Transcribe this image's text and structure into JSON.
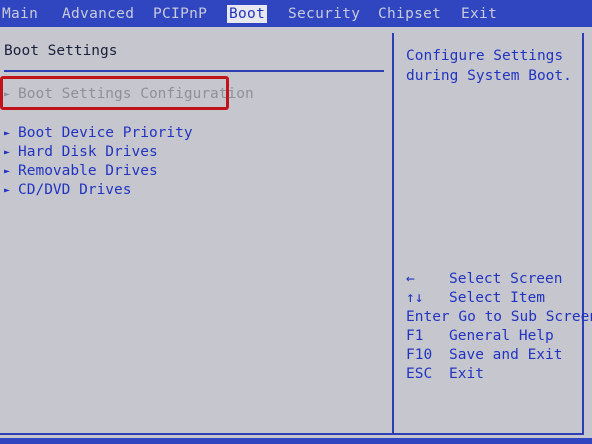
{
  "menubar": {
    "tabs": [
      {
        "label": "Main"
      },
      {
        "label": "Advanced"
      },
      {
        "label": "PCIPnP"
      },
      {
        "label": "Boot"
      },
      {
        "label": "Security"
      },
      {
        "label": "Chipset"
      },
      {
        "label": "Exit"
      }
    ]
  },
  "left_pane": {
    "title": "Boot Settings",
    "items": [
      {
        "label": "Boot Settings Configuration",
        "arrow": "►"
      },
      {
        "label": "Boot Device Priority",
        "arrow": "►"
      },
      {
        "label": "Hard Disk Drives",
        "arrow": "►"
      },
      {
        "label": "Removable Drives",
        "arrow": "►"
      },
      {
        "label": "CD/DVD Drives",
        "arrow": "►"
      }
    ]
  },
  "help_pane": {
    "text": "Configure Settings during System Boot.",
    "keys": [
      {
        "key": "←",
        "action": "Select Screen"
      },
      {
        "key": "↑↓",
        "action": "Select Item"
      },
      {
        "key": "Enter",
        "action": "Go to Sub Screen"
      },
      {
        "key": "F1",
        "action": "General Help"
      },
      {
        "key": "F10",
        "action": "Save and Exit"
      },
      {
        "key": "ESC",
        "action": "Exit"
      }
    ]
  },
  "colors": {
    "background_blue": "#2a3fb8",
    "panel_gray": "#c6c7ce",
    "text_blue": "#2233c0",
    "highlight_red": "#c0141a"
  }
}
